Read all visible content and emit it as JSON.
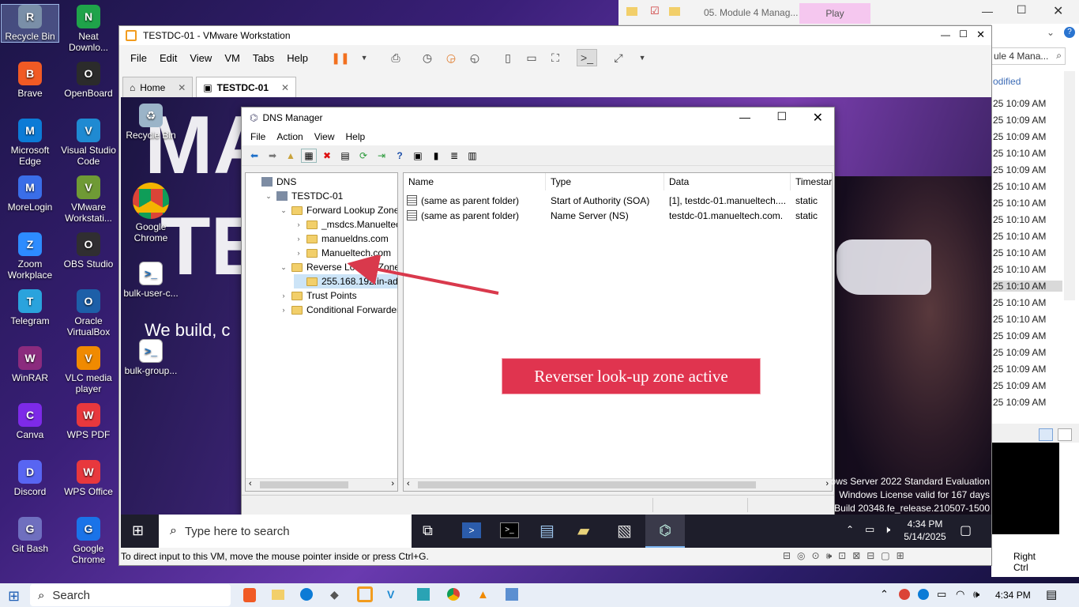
{
  "host_desktop": {
    "icons": [
      {
        "label": "Recycle Bin",
        "name": "recycle-bin",
        "color": "#7a8fa8"
      },
      {
        "label": "Neat Downlo...",
        "name": "neat-download",
        "color": "#1fa34a"
      },
      {
        "label": "Brave",
        "name": "brave",
        "color": "#f15a24"
      },
      {
        "label": "OpenBoard",
        "name": "openboard",
        "color": "#2b2b2b"
      },
      {
        "label": "Microsoft Edge",
        "name": "edge",
        "color": "#0c7bd6"
      },
      {
        "label": "Visual Studio Code",
        "name": "vscode",
        "color": "#1f8ad2"
      },
      {
        "label": "MoreLogin",
        "name": "morelogin",
        "color": "#3a6ee8"
      },
      {
        "label": "VMware Workstati...",
        "name": "vmware",
        "color": "#6f9a35"
      },
      {
        "label": "Zoom Workplace",
        "name": "zoom",
        "color": "#2d8cff"
      },
      {
        "label": "OBS Studio",
        "name": "obs",
        "color": "#302e31"
      },
      {
        "label": "Telegram",
        "name": "telegram",
        "color": "#2aa3dd"
      },
      {
        "label": "Oracle VirtualBox",
        "name": "virtualbox",
        "color": "#1d5fa8"
      },
      {
        "label": "WinRAR",
        "name": "winrar",
        "color": "#8b2b7e"
      },
      {
        "label": "VLC media player",
        "name": "vlc",
        "color": "#f08a00"
      },
      {
        "label": "Canva",
        "name": "canva",
        "color": "#7d2ae8"
      },
      {
        "label": "WPS PDF",
        "name": "wps-pdf",
        "color": "#e8383d"
      },
      {
        "label": "Discord",
        "name": "discord",
        "color": "#5865f2"
      },
      {
        "label": "WPS Office",
        "name": "wps-office",
        "color": "#e8383d"
      },
      {
        "label": "Git Bash",
        "name": "git-bash",
        "color": "#6f6fbf"
      },
      {
        "label": "Google Chrome",
        "name": "chrome",
        "color": "#1a73e8"
      }
    ]
  },
  "explorer_frag": {
    "tab_title": "05. Module 4 Manag...",
    "play_label": "Play",
    "search_text": "ule 4 Mana...",
    "modified_label": "odified",
    "times": [
      "25 10:09 AM",
      "25 10:09 AM",
      "25 10:09 AM",
      "25 10:10 AM",
      "25 10:09 AM",
      "25 10:10 AM",
      "25 10:10 AM",
      "25 10:10 AM",
      "25 10:10 AM",
      "25 10:10 AM",
      "25 10:10 AM",
      "25 10:10 AM",
      "25 10:10 AM",
      "25 10:10 AM",
      "25 10:09 AM",
      "25 10:09 AM",
      "25 10:09 AM",
      "25 10:09 AM",
      "25 10:09 AM"
    ]
  },
  "vmware": {
    "title": "TESTDC-01 - VMware Workstation",
    "menu": [
      "File",
      "Edit",
      "View",
      "VM",
      "Tabs",
      "Help"
    ],
    "tabs": [
      {
        "label": "Home"
      },
      {
        "label": "TESTDC-01"
      }
    ],
    "status_text": "To direct input to this VM, move the mouse pointer inside or press Ctrl+G.",
    "right_ctrl": "Right Ctrl"
  },
  "guest": {
    "desktop_icons": [
      {
        "label": "Recycle Bin"
      },
      {
        "label": "Google Chrome"
      },
      {
        "label": "bulk-user-c..."
      },
      {
        "label": "bulk-group..."
      }
    ],
    "wallpaper_text": {
      "big1": "MA",
      "big2": "TE",
      "tagline": "We build, c"
    },
    "watermark": [
      "ows Server 2022 Standard Evaluation",
      "Windows License valid for 167 days",
      "Build 20348.fe_release.210507-1500"
    ],
    "taskbar": {
      "search_placeholder": "Type here to search",
      "time": "4:34 PM",
      "date": "5/14/2025"
    }
  },
  "dns": {
    "title": "DNS Manager",
    "menu": [
      "File",
      "Action",
      "View",
      "Help"
    ],
    "tree": [
      {
        "label": "DNS",
        "level": 0,
        "expander": ""
      },
      {
        "label": "TESTDC-01",
        "level": 1,
        "expander": "v"
      },
      {
        "label": "Forward Lookup Zones",
        "level": 2,
        "expander": "v"
      },
      {
        "label": "_msdcs.Manueltech.c",
        "level": 3,
        "expander": ">"
      },
      {
        "label": "manueldns.com",
        "level": 3,
        "expander": ">"
      },
      {
        "label": "Manueltech.com",
        "level": 3,
        "expander": ">"
      },
      {
        "label": "Reverse Lookup Zones",
        "level": 2,
        "expander": "v"
      },
      {
        "label": "255.168.192.in-addr.a",
        "level": 3,
        "expander": ""
      },
      {
        "label": "Trust Points",
        "level": 2,
        "expander": ">"
      },
      {
        "label": "Conditional Forwarders",
        "level": 2,
        "expander": ">"
      }
    ],
    "columns": [
      "Name",
      "Type",
      "Data",
      "Timestar"
    ],
    "rows": [
      {
        "name": "(same as parent folder)",
        "type": "Start of Authority (SOA)",
        "data": "[1], testdc-01.manueltech....",
        "ts": "static"
      },
      {
        "name": "(same as parent folder)",
        "type": "Name Server (NS)",
        "data": "testdc-01.manueltech.com.",
        "ts": "static"
      }
    ]
  },
  "callout": {
    "text": "Reverser look-up zone active",
    "color": "#e0344f"
  },
  "host_taskbar": {
    "search_label": "Search",
    "time": "4:34 PM"
  }
}
